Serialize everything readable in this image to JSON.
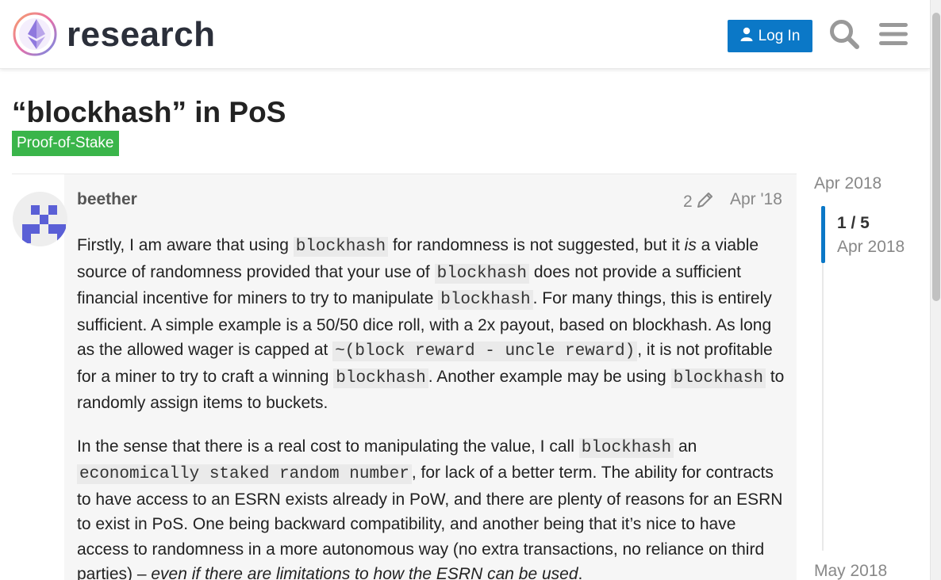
{
  "header": {
    "logo_text": "research",
    "login_label": "Log In"
  },
  "topic": {
    "title": "“blockhash” in PoS",
    "category": "Proof-of-Stake",
    "category_color": "#3ab54a"
  },
  "post": {
    "username": "beether",
    "edit_count": "2",
    "date": "Apr '18",
    "p1": {
      "t1": "Firstly, I am aware that using ",
      "c1": "blockhash",
      "t2": " for randomness is not suggested, but it ",
      "em1": "is",
      "t3": " a viable source of randomness provided that your use of ",
      "c2": "blockhash",
      "t4": " does not provide a sufficient financial incentive for miners to try to manipulate ",
      "c3": "blockhash",
      "t5": ". For many things, this is entirely sufficient. A simple example is a 50/50 dice roll, with a 2x payout, based on blockhash. As long as the allowed wager is capped at ",
      "c4": "~(block reward - uncle reward)",
      "t6": ", it is not profitable for a miner to try to craft a winning ",
      "c5": "blockhash",
      "t7": ". Another example may be using ",
      "c6": "blockhash",
      "t8": " to randomly assign items to buckets."
    },
    "p2": {
      "t1": "In the sense that there is a real cost to manipulating the value, I call ",
      "c1": "blockhash",
      "t2": " an ",
      "c2": "economically staked random number",
      "t3": ", for lack of a better term. The ability for contracts to have access to an ESRN exists already in PoW, and there are plenty of reasons for an ESRN to exist in PoS. One being backward compatibility, and another being that it’s nice to have access to randomness in a more autonomous way (no extra transactions, no reliance on third parties) – ",
      "em1": "even if there are limitations to how the ESRN can be used",
      "t4": "."
    }
  },
  "timeline": {
    "start": "Apr 2018",
    "position": "1 / 5",
    "position_date": "Apr 2018",
    "end": "May 2018"
  },
  "colors": {
    "accent": "#0b78c7",
    "category": "#3ab54a"
  },
  "icons": [
    "ethereum-logo-icon",
    "user-icon",
    "search-icon",
    "menu-icon",
    "pencil-icon"
  ]
}
